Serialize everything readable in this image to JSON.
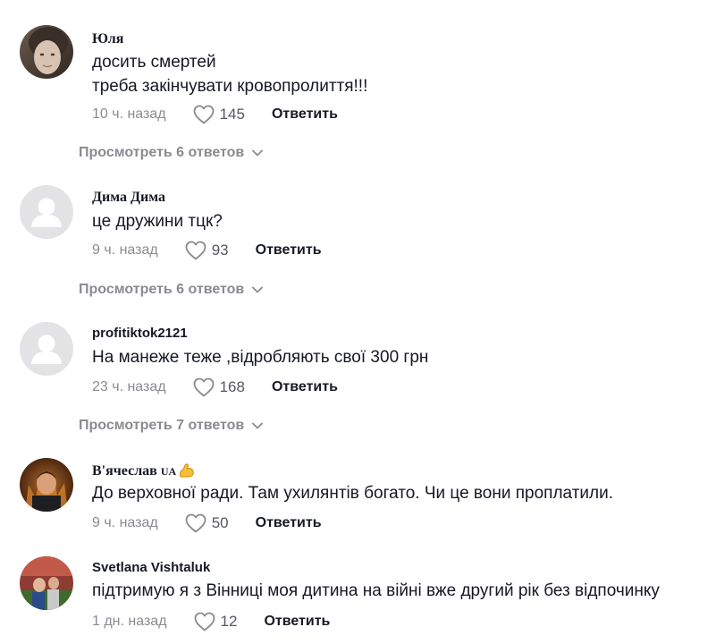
{
  "comments": [
    {
      "author": "Юля",
      "lines": [
        "досить смертей",
        "треба закінчувати кровопролиття!!!"
      ],
      "time": "10 ч. назад",
      "likes": "145",
      "reply_label": "Ответить",
      "replies_label": "Просмотреть 6 ответов",
      "avatar": "photo-woman"
    },
    {
      "author": "Дима Дима",
      "lines": [
        "це дружини тцк?"
      ],
      "time": "9 ч. назад",
      "likes": "93",
      "reply_label": "Ответить",
      "replies_label": "Просмотреть 6 ответов",
      "avatar": "default-user-icon"
    },
    {
      "author": "profitiktok2121",
      "lines": [
        "На манеже теже ,відробляють свої 300 грн"
      ],
      "time": "23 ч. назад",
      "likes": "168",
      "reply_label": "Ответить",
      "replies_label": "Просмотреть 7 ответов",
      "avatar": "default-user-icon"
    },
    {
      "author": "В'ячеслав",
      "author_badge": "UA",
      "author_emoji": "flexed-biceps-icon",
      "lines": [
        "До верховної ради. Там ухилянтів богато. Чи це вони проплатили."
      ],
      "time": "9 ч. назад",
      "likes": "50",
      "reply_label": "Ответить",
      "avatar": "photo-man"
    },
    {
      "author": "Svetlana Vishtaluk",
      "lines": [
        "підтримую я з Вінниці моя дитина на війні вже другий рік без відпочинку"
      ],
      "time": "1 дн. назад",
      "likes": "12",
      "reply_label": "Ответить",
      "avatar": "photo-group"
    }
  ],
  "colors": {
    "text": "#161823",
    "muted": "#8a8b91",
    "avatar_placeholder": "#e3e3e6",
    "avatar_glyph": "#ffffff"
  }
}
